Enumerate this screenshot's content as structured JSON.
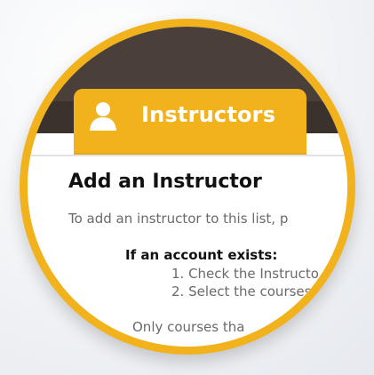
{
  "tab": {
    "label": "Instructors",
    "icon": "user-icon"
  },
  "panel": {
    "title": "Add an Instructor",
    "description": "To add an instructor to this list, p",
    "subheading": "If an account exists:",
    "steps": [
      "1. Check the Instructo",
      "2. Select the courses"
    ],
    "note": "Only courses tha"
  },
  "colors": {
    "accent": "#f2b21b",
    "header": "#4a3f39",
    "text_dark": "#111111",
    "text_muted": "#6a6a6a"
  }
}
